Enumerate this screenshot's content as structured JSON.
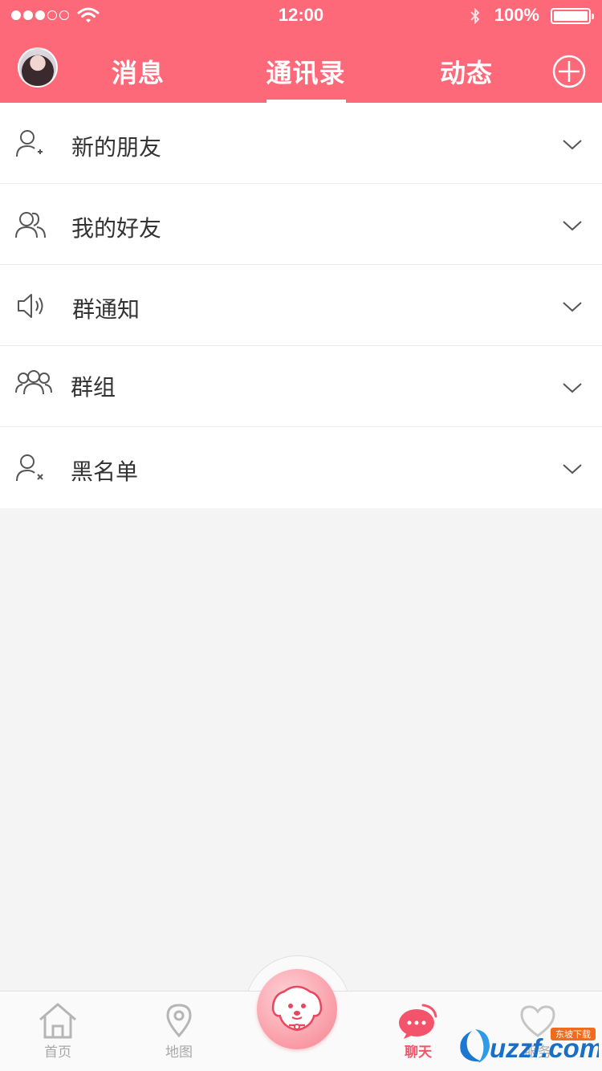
{
  "status_bar": {
    "time": "12:00",
    "battery": "100%",
    "signal_bars": 5,
    "signal_filled": 3
  },
  "header": {
    "tabs": [
      {
        "label": "消息"
      },
      {
        "label": "通讯录"
      },
      {
        "label": "动态"
      }
    ],
    "active_tab": "通讯录",
    "add_icon": "plus-circle-icon"
  },
  "contacts": {
    "items": [
      {
        "label": "新的朋友",
        "icon": "user-plus-icon"
      },
      {
        "label": "我的好友",
        "icon": "users-icon"
      },
      {
        "label": "群通知",
        "icon": "speaker-icon"
      },
      {
        "label": "群组",
        "icon": "group-icon"
      },
      {
        "label": "黑名单",
        "icon": "user-block-icon"
      }
    ]
  },
  "tabbar": {
    "items": [
      {
        "label": "首页",
        "icon": "home-icon"
      },
      {
        "label": "地图",
        "icon": "map-pin-icon"
      },
      {
        "label": "聊天",
        "icon": "chat-bubble-icon"
      },
      {
        "label": "服务",
        "icon": "heart-icon"
      }
    ],
    "active": "聊天",
    "center_icon": "puppy-icon"
  },
  "watermark": {
    "text": "uzzf.com",
    "tag": "东坡下载"
  },
  "colors": {
    "accent": "#fd6979",
    "active_tab_label": "#f4546b",
    "background": "#f4f4f4"
  }
}
